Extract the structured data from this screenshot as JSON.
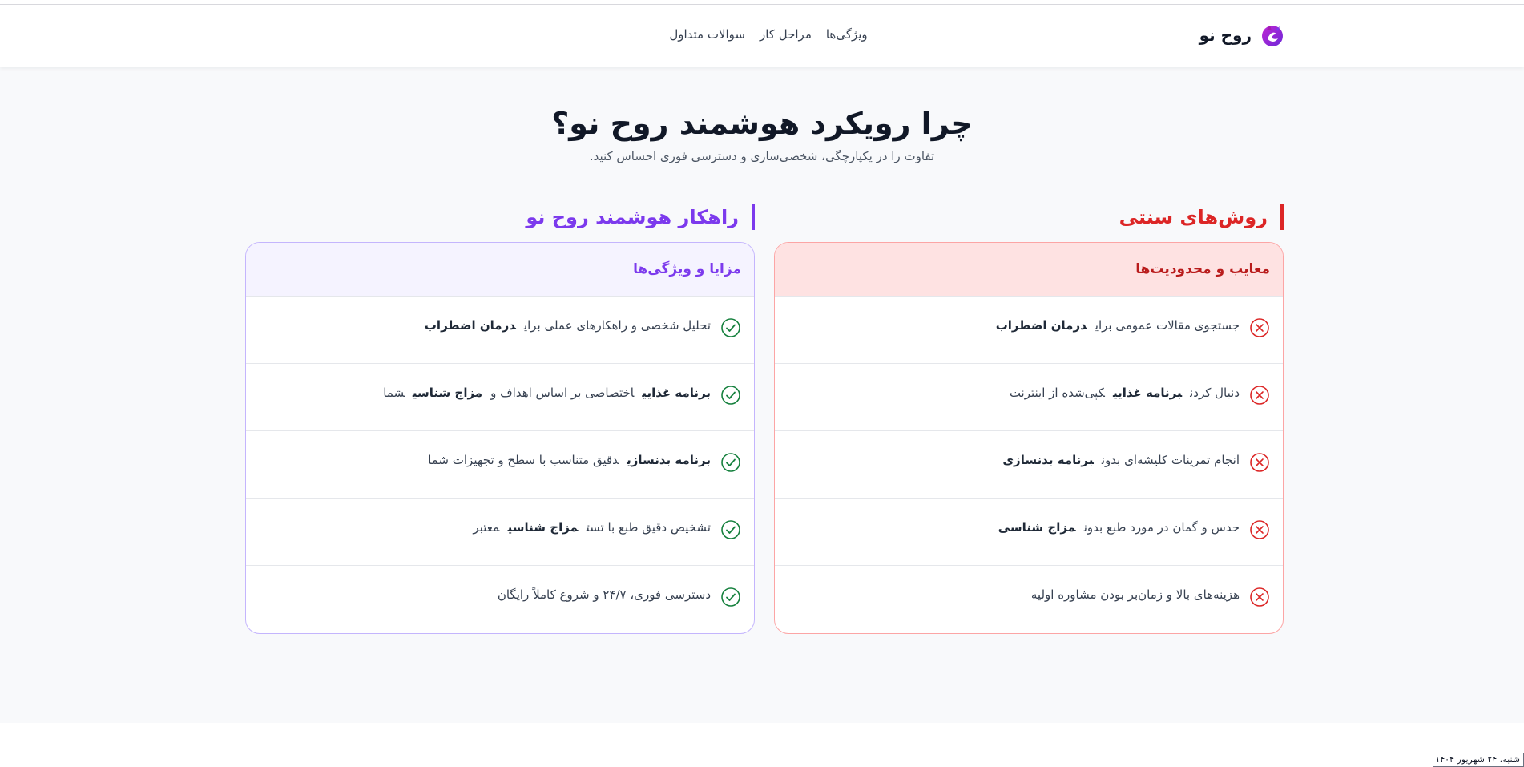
{
  "header": {
    "brand_name": "روح نو",
    "nav": [
      "ویژگی‌ها",
      "مراحل کار",
      "سوالات متداول"
    ]
  },
  "hero": {
    "title": "چرا رویکرد هوشمند روح نو؟",
    "subtitle": "تفاوت را در یکپارچگی، شخصی‌سازی و دسترسی فوری احساس کنید."
  },
  "traditional": {
    "heading": "روش‌های سنتی",
    "card_title": "معایب و محدودیت‌ها",
    "rows": [
      [
        "جستجوی مقالات عمومی برای",
        "درمان اضطراب",
        ""
      ],
      [
        "دنبال کردن",
        "برنامه غذایی",
        "کپی‌شده از اینترنت"
      ],
      [
        "انجام تمرینات کلیشه‌ای بدون",
        "برنامه بدنسازی",
        ""
      ],
      [
        "حدس و گمان در مورد طبع بدون",
        "مزاج شناسی",
        ""
      ],
      [
        "هزینه‌های بالا و زمان‌بر بودن مشاوره اولیه",
        "",
        ""
      ]
    ]
  },
  "smart": {
    "heading": "راهکار هوشمند روح نو",
    "card_title": "مزایا و ویژگی‌ها",
    "rows": [
      [
        "تحلیل شخصی و راهکارهای عملی برای",
        "درمان اضطراب",
        "",
        "",
        ""
      ],
      [
        "",
        "برنامه غذایی",
        "اختصاصی بر اساس اهداف و",
        "مزاج شناسی",
        "شما"
      ],
      [
        "",
        "برنامه بدنسازی",
        "دقیق متناسب با سطح و تجهیزات شما",
        "",
        ""
      ],
      [
        "تشخیص دقیق طبع با تست",
        "مزاج شناسی",
        "معتبر",
        "",
        ""
      ],
      [
        "دسترسی فوری، ۲۴/۷ و شروع کاملاً رایگان",
        "",
        "",
        "",
        ""
      ]
    ]
  },
  "status_date": "شنبه، ۲۴ شهریور ۱۴۰۴",
  "colors": {
    "traditional_accent": "#dc2626",
    "smart_accent": "#7c3aed",
    "check": "#15803d",
    "cross": "#dc2626"
  },
  "icons": {
    "logo": "brand-logo-icon",
    "traditional_row": "x-circle-icon",
    "smart_row": "check-circle-icon"
  }
}
